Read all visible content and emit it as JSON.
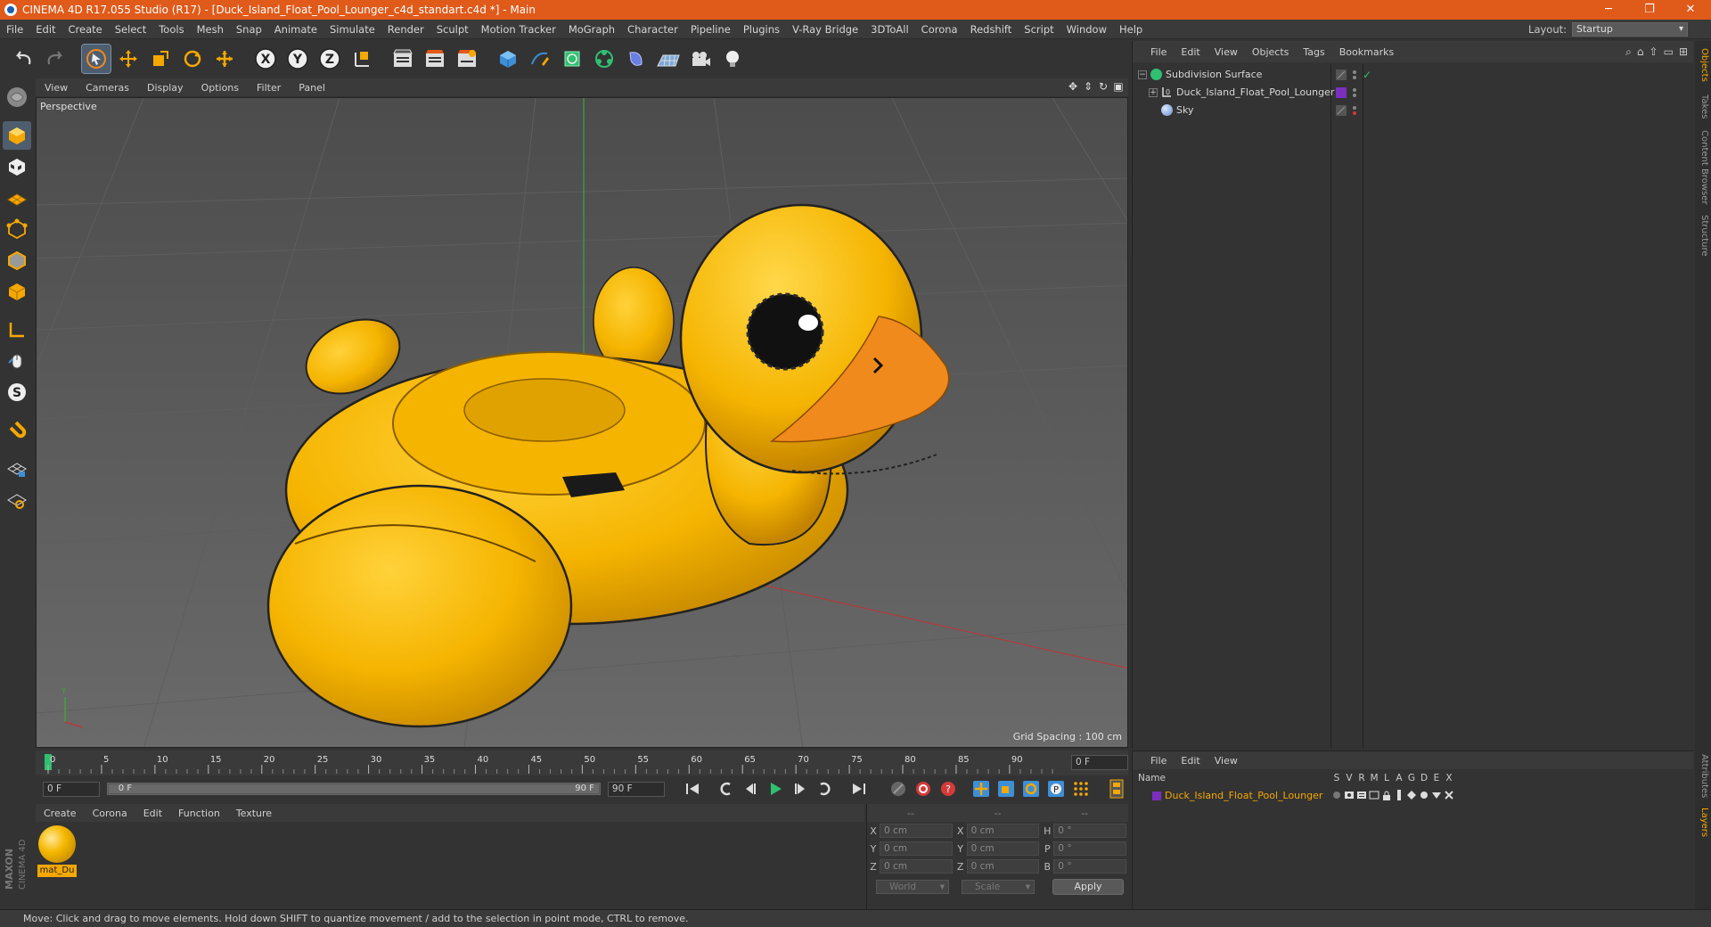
{
  "app": {
    "title": "CINEMA 4D R17.055 Studio (R17) - [Duck_Island_Float_Pool_Lounger_c4d_standart.c4d *] - Main",
    "window_controls": [
      "─",
      "❐",
      "✕"
    ]
  },
  "menubar": {
    "items": [
      "File",
      "Edit",
      "Create",
      "Select",
      "Tools",
      "Mesh",
      "Snap",
      "Animate",
      "Simulate",
      "Render",
      "Sculpt",
      "Motion Tracker",
      "MoGraph",
      "Character",
      "Pipeline",
      "Plugins",
      "V-Ray Bridge",
      "3DToAll",
      "Corona",
      "Redshift",
      "Script",
      "Window",
      "Help"
    ],
    "layout_label": "Layout:",
    "layout_value": "Startup"
  },
  "toolbar": {
    "undo_icon": "undo-icon",
    "redo_icon": "redo-icon",
    "axis_x": "X",
    "axis_y": "Y",
    "axis_z": "Z"
  },
  "viewport": {
    "menu": [
      "View",
      "Cameras",
      "Display",
      "Options",
      "Filter",
      "Panel"
    ],
    "label": "Perspective",
    "grid_spacing": "Grid Spacing : 100 cm"
  },
  "timeline": {
    "ticks": [
      "0",
      "5",
      "10",
      "15",
      "20",
      "25",
      "30",
      "35",
      "40",
      "45",
      "50",
      "55",
      "60",
      "65",
      "70",
      "75",
      "80",
      "85",
      "90"
    ],
    "current_frame": "0 F"
  },
  "transport": {
    "start_field": "0 F",
    "range_left": "0 F",
    "range_right": "90 F",
    "end_field": "90 F"
  },
  "material_manager": {
    "menu": [
      "Create",
      "Corona",
      "Edit",
      "Function",
      "Texture"
    ],
    "material_name": "mat_Du"
  },
  "coordinates": {
    "headers": [
      "--",
      "--",
      "--"
    ],
    "rows": [
      {
        "l1": "X",
        "v1": "0 cm",
        "l2": "X",
        "v2": "0 cm",
        "l3": "H",
        "v3": "0 °"
      },
      {
        "l1": "Y",
        "v1": "0 cm",
        "l2": "Y",
        "v2": "0 cm",
        "l3": "P",
        "v3": "0 °"
      },
      {
        "l1": "Z",
        "v1": "0 cm",
        "l2": "Z",
        "v2": "0 cm",
        "l3": "B",
        "v3": "0 °"
      }
    ],
    "world": "World",
    "scale": "Scale",
    "apply": "Apply"
  },
  "object_manager": {
    "menu": [
      "File",
      "Edit",
      "View",
      "Objects",
      "Tags",
      "Bookmarks"
    ],
    "objects": [
      {
        "name": "Subdivision Surface",
        "expand": "−"
      },
      {
        "name": "Duck_Island_Float_Pool_Lounger",
        "expand": "+"
      },
      {
        "name": "Sky",
        "expand": ""
      }
    ]
  },
  "layer_manager": {
    "menu": [
      "File",
      "Edit",
      "View"
    ],
    "name_header": "Name",
    "flags": [
      "S",
      "V",
      "R",
      "M",
      "L",
      "A",
      "G",
      "D",
      "E",
      "X"
    ],
    "layer_name": "Duck_Island_Float_Pool_Lounger"
  },
  "right_tabs": [
    "Objects",
    "Takes",
    "Content Browser",
    "Structure",
    "Attributes",
    "Layers"
  ],
  "status": "Move: Click and drag to move elements. Hold down SHIFT to quantize movement / add to the selection in point mode, CTRL to remove.",
  "colors": {
    "accent": "#e05a1a",
    "duck_yellow": "#f5b400",
    "beak_orange": "#f08a1c",
    "layer_purple": "#7b2fbe",
    "material_orange": "#f5a800"
  }
}
